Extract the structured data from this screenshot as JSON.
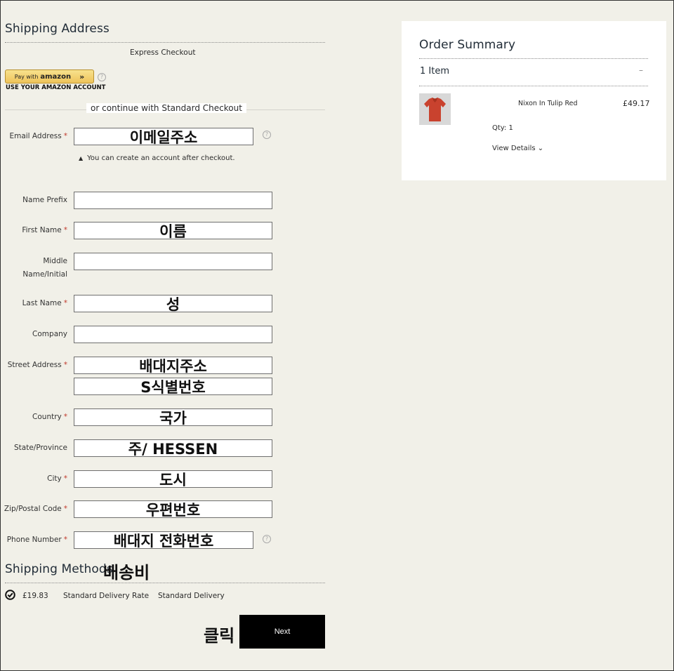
{
  "shipping": {
    "title": "Shipping Address",
    "express_label": "Express Checkout",
    "amazon_pay_with": "Pay with",
    "amazon_brand": "amazon",
    "amazon_chevron": "»",
    "amazon_sub": "USE YOUR AMAZON ACCOUNT",
    "help_glyph": "?",
    "or_continue": "or continue with Standard Checkout",
    "account_note": "You can create an account after checkout.",
    "required_mark": "*",
    "fields": {
      "email": {
        "label": "Email Address",
        "value": "이메일주소"
      },
      "prefix": {
        "label": "Name Prefix",
        "value": ""
      },
      "first": {
        "label": "First Name",
        "value": "이름"
      },
      "middle_line1": "Middle",
      "middle_line2": "Name/Initial",
      "middle_value": "",
      "last": {
        "label": "Last Name",
        "value": "성"
      },
      "company": {
        "label": "Company",
        "value": ""
      },
      "street": {
        "label": "Street Address",
        "value1": "배대지주소",
        "value2": "S식별번호"
      },
      "country": {
        "label": "Country",
        "value": "국가"
      },
      "state": {
        "label": "State/Province",
        "value": "주/ HESSEN"
      },
      "city": {
        "label": "City",
        "value": "도시"
      },
      "zip": {
        "label": "Zip/Postal Code",
        "value": "우편번호"
      },
      "phone": {
        "label": "Phone Number",
        "value": "배대지 전화번호"
      }
    }
  },
  "methods": {
    "title": "Shipping Methods",
    "annotation": "배송비",
    "price": "£19.83",
    "rate": "Standard Delivery Rate",
    "name": "Standard Delivery"
  },
  "next": {
    "label": "Next",
    "annotation": "클릭"
  },
  "summary": {
    "title": "Order Summary",
    "items_count": "1 Item",
    "collapse": "–",
    "product_name": "Nixon In Tulip Red",
    "price": "£49.17",
    "qty": "Qty: 1",
    "view_details": "View Details",
    "chevron": "⌄"
  },
  "colors": {
    "background": "#f1f0e8",
    "required": "#c0392b",
    "shirt": "#c9422e",
    "button": "#000000"
  }
}
